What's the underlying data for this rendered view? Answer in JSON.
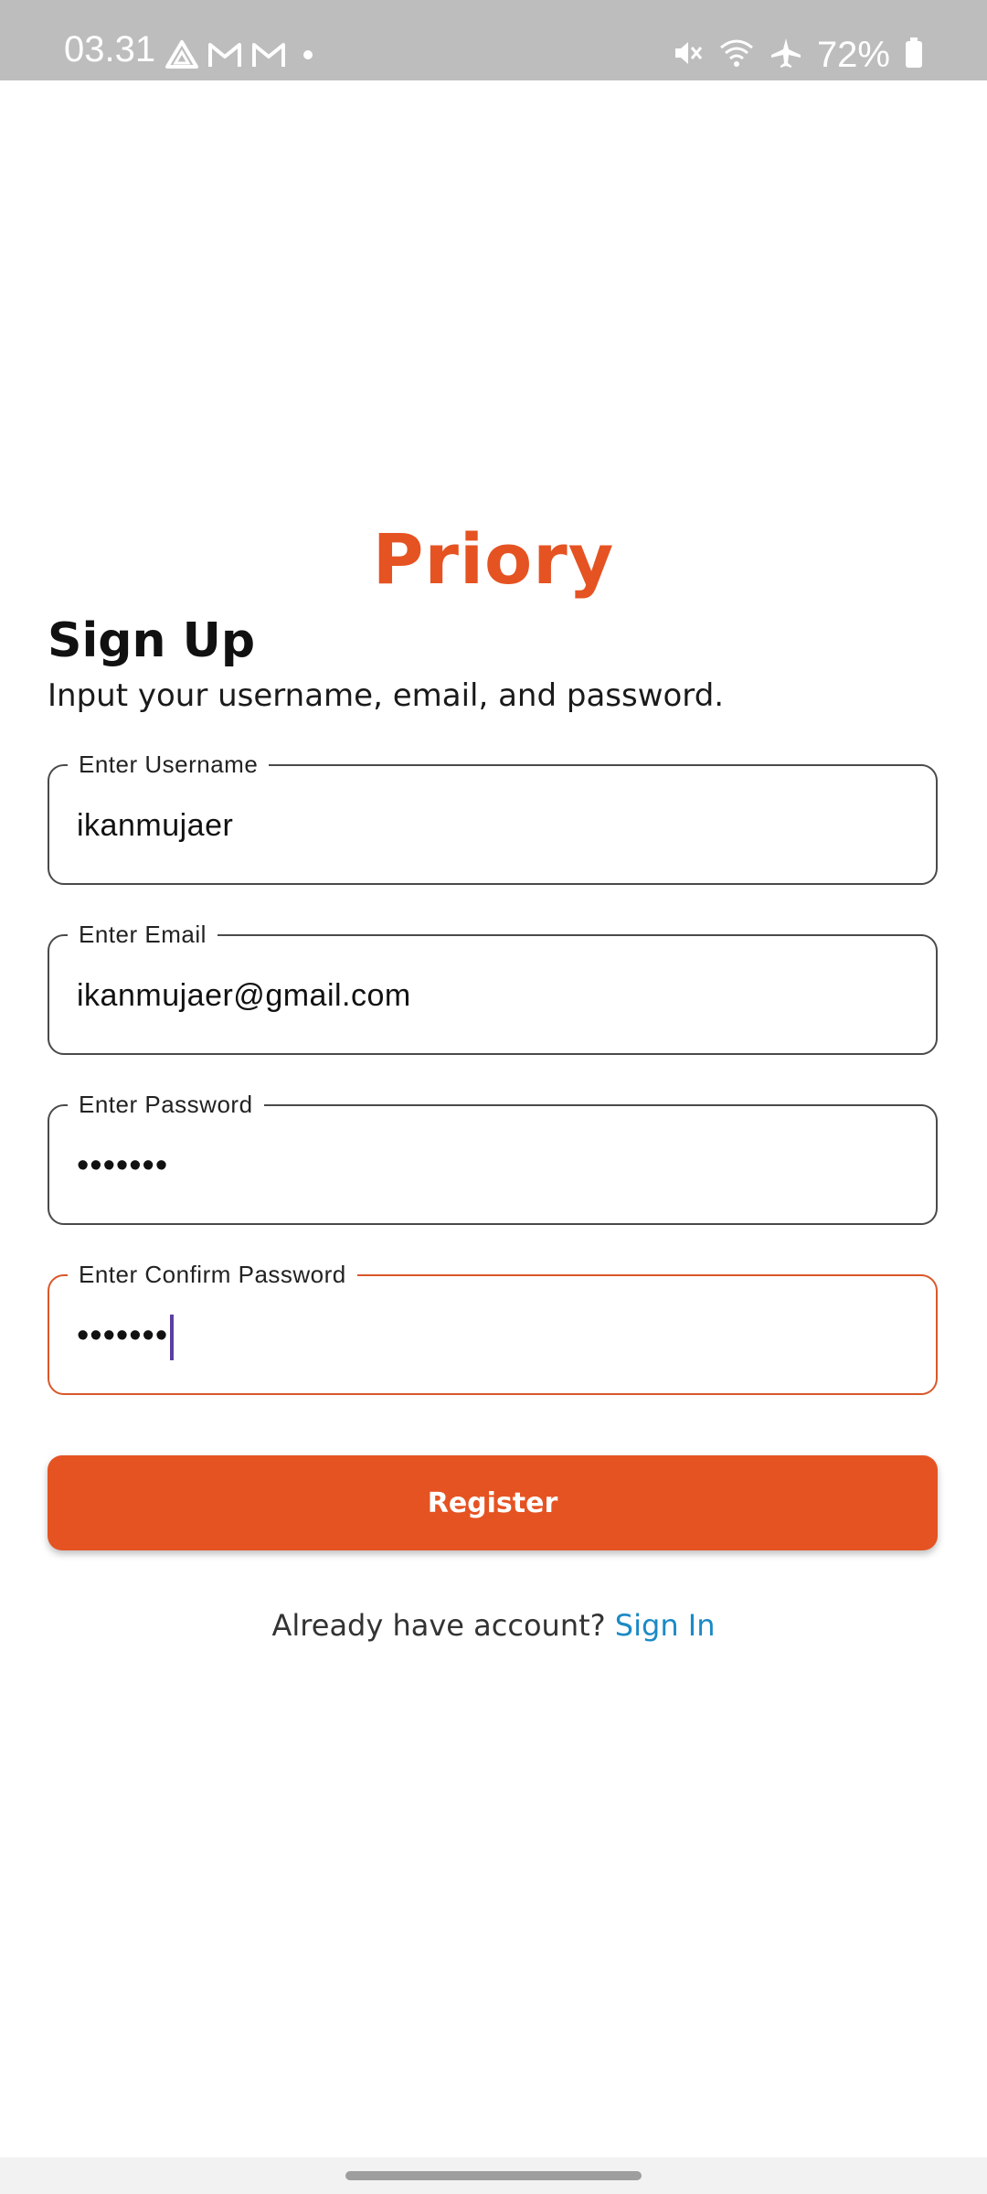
{
  "status_bar": {
    "time": "03.31",
    "battery_percent": "72%",
    "icons_left": [
      "drive-icon",
      "gmail-icon",
      "gmail-icon",
      "dot-icon"
    ],
    "icons_right": [
      "mute-icon",
      "wifi-icon",
      "airplane-icon",
      "battery-icon"
    ]
  },
  "app": {
    "title": "Priory",
    "accent_color": "#e55322"
  },
  "form": {
    "heading": "Sign Up",
    "subheading": "Input your username, email, and password.",
    "fields": {
      "username": {
        "label": "Enter Username",
        "value": "ikanmujaer"
      },
      "email": {
        "label": "Enter Email",
        "value": "ikanmujaer@gmail.com"
      },
      "password": {
        "label": "Enter Password",
        "value": "•••••••"
      },
      "confirm_password": {
        "label": "Enter Confirm Password",
        "value": "•••••••",
        "focused": true
      }
    },
    "register_label": "Register",
    "signin_prompt": "Already have account?",
    "signin_link": "Sign In",
    "link_color": "#1b8ac5"
  }
}
